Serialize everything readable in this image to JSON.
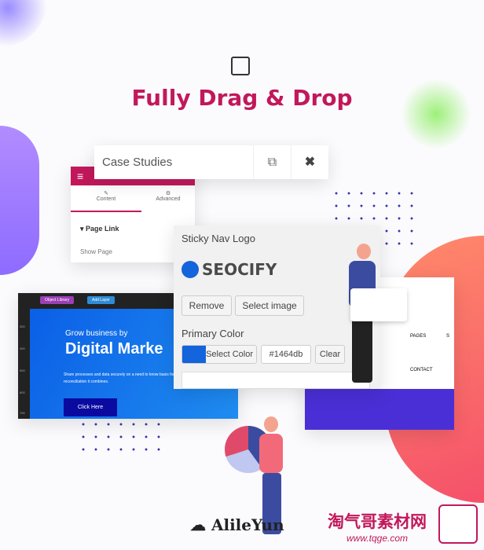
{
  "heading": "Fully Drag & Drop",
  "heading_icon": "drag-drop-window-icon",
  "case_bar": {
    "title": "Case Studies",
    "copy_icon": "copy-icon",
    "close_icon": "close-icon"
  },
  "side_panel": {
    "menu_icon": "hamburger-icon",
    "tabs": [
      {
        "label": "Content",
        "icon": "pencil-icon"
      },
      {
        "label": "Advanced",
        "icon": "gear-icon"
      }
    ],
    "section": "Page Link",
    "field": "Show Page"
  },
  "logo_panel": {
    "title": "Sticky Nav Logo",
    "logo_text": "SEOCIFY",
    "remove": "Remove",
    "select_image": "Select image",
    "color_label": "Primary Color",
    "select_color": "Select Color",
    "color_value": "#1464db",
    "clear": "Clear"
  },
  "slider": {
    "object_library": "Object Library",
    "add_layer": "Add Layer",
    "ruler": [
      "300",
      "400",
      "500",
      "600",
      "700"
    ],
    "kicker": "Grow business by",
    "headline": "Digital Marke",
    "body": "Share processes and data securely on a need to know basis for reconciliation it combines.",
    "cta": "Click Here"
  },
  "nav_preview": {
    "items": [
      "PAGES",
      "S",
      "CONTACT"
    ]
  },
  "watermarks": {
    "left": "AlileYun",
    "right": "淘气哥素材网",
    "right_url": "www.tqge.com"
  },
  "colors": {
    "accent": "#c2185b",
    "blue": "#1464db",
    "purple": "#4a2fd6"
  }
}
